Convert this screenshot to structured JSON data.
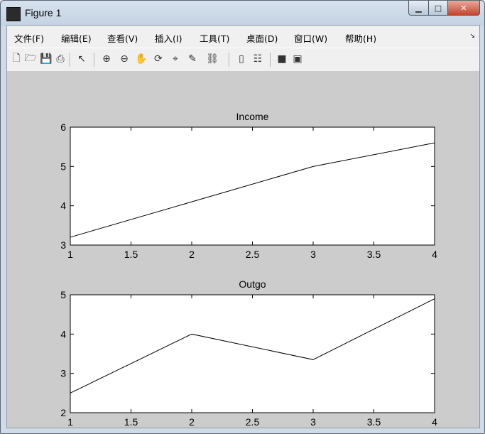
{
  "window": {
    "title": "Figure 1",
    "buttons": {
      "minimize": "▁",
      "maximize": "□",
      "close": "✕"
    }
  },
  "menu": [
    "文件(F)",
    "编辑(E)",
    "查看(V)",
    "插入(I)",
    "工具(T)",
    "桌面(D)",
    "窗口(W)",
    "帮助(H)"
  ],
  "toolbar": [
    {
      "name": "new-figure-icon",
      "glyph": "🗋"
    },
    {
      "name": "open-file-icon",
      "glyph": "🗁"
    },
    {
      "name": "save-icon",
      "glyph": "💾"
    },
    {
      "name": "print-icon",
      "glyph": "⎙"
    },
    {
      "name": "edit-plot-arrow-icon",
      "glyph": "↖"
    },
    {
      "name": "zoom-in-icon",
      "glyph": "⊕"
    },
    {
      "name": "zoom-out-icon",
      "glyph": "⊖"
    },
    {
      "name": "pan-hand-icon",
      "glyph": "✋"
    },
    {
      "name": "rotate-3d-icon",
      "glyph": "⟳"
    },
    {
      "name": "data-cursor-icon",
      "glyph": "⌖"
    },
    {
      "name": "brush-icon",
      "glyph": "✎"
    },
    {
      "name": "link-plot-icon",
      "glyph": "⛓"
    },
    {
      "name": "colorbar-icon",
      "glyph": "▯"
    },
    {
      "name": "legend-icon",
      "glyph": "☷"
    },
    {
      "name": "hide-plot-tools-icon",
      "glyph": "■"
    },
    {
      "name": "show-plot-tools-icon",
      "glyph": "▣"
    }
  ],
  "colors": {
    "figure_bg": "#cccccc",
    "axes_bg": "#ffffff",
    "line": "#000000"
  },
  "chart_data": [
    {
      "type": "line",
      "title": "Income",
      "x": [
        1,
        2,
        3,
        4
      ],
      "series": [
        {
          "values": [
            3.2,
            4.1,
            5.0,
            5.6
          ]
        }
      ],
      "xlim": [
        1,
        4
      ],
      "ylim": [
        3,
        6
      ],
      "xticks": [
        "1",
        "1.5",
        "2",
        "2.5",
        "3",
        "3.5",
        "4"
      ],
      "yticks": [
        "3",
        "4",
        "5",
        "6"
      ],
      "grid": false
    },
    {
      "type": "line",
      "title": "Outgo",
      "x": [
        1,
        2,
        3,
        4
      ],
      "series": [
        {
          "values": [
            2.5,
            4.0,
            3.35,
            4.9
          ]
        }
      ],
      "xlim": [
        1,
        4
      ],
      "ylim": [
        2,
        5
      ],
      "xticks": [
        "1",
        "1.5",
        "2",
        "2.5",
        "3",
        "3.5",
        "4"
      ],
      "yticks": [
        "2",
        "3",
        "4",
        "5"
      ],
      "grid": false
    }
  ]
}
